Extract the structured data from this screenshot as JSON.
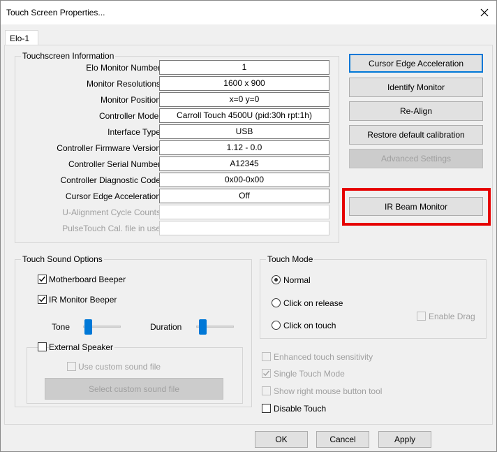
{
  "window": {
    "title": "Touch Screen Properties..."
  },
  "tabs": [
    {
      "label": "Elo-1"
    }
  ],
  "touchscreen_info": {
    "group_label": "Touchscreen Information",
    "rows": [
      {
        "label": "Elo Monitor Number",
        "value": "1",
        "enabled": true
      },
      {
        "label": "Monitor Resolutions",
        "value": "1600 x 900",
        "enabled": true
      },
      {
        "label": "Monitor Position",
        "value": "x=0  y=0",
        "enabled": true
      },
      {
        "label": "Controller Model",
        "value": "Carroll Touch 4500U (pid:30h rpt:1h)",
        "enabled": true
      },
      {
        "label": "Interface Type",
        "value": "USB",
        "enabled": true
      },
      {
        "label": "Controller Firmware Version",
        "value": "1.12 - 0.0",
        "enabled": true
      },
      {
        "label": "Controller Serial Number",
        "value": "A12345",
        "enabled": true
      },
      {
        "label": "Controller Diagnostic Code",
        "value": "0x00-0x00",
        "enabled": true
      },
      {
        "label": "Cursor Edge Acceleration",
        "value": "Off",
        "enabled": true
      },
      {
        "label": "U-Alignment Cycle Counts",
        "value": "",
        "enabled": false
      },
      {
        "label": "PulseTouch Cal. file in use",
        "value": "",
        "enabled": false
      }
    ]
  },
  "buttons": {
    "cursor_edge": "Cursor Edge Acceleration",
    "identify": "Identify Monitor",
    "realign": "Re-Align",
    "restore": "Restore default calibration",
    "advanced": "Advanced Settings",
    "ir_beam": "IR Beam Monitor"
  },
  "sound": {
    "group_label": "Touch Sound Options",
    "motherboard_beeper": "Motherboard Beeper",
    "motherboard_checked": true,
    "ir_monitor_beeper": "IR Monitor Beeper",
    "ir_checked": true,
    "tone_label": "Tone",
    "duration_label": "Duration",
    "external_speaker": "External Speaker",
    "external_checked": false,
    "use_custom": "Use custom sound file",
    "select_custom": "Select custom sound file"
  },
  "touch_mode": {
    "group_label": "Touch Mode",
    "options": [
      "Normal",
      "Click on release",
      "Click on touch"
    ],
    "selected": "Normal",
    "enable_drag": "Enable Drag"
  },
  "extra_options": {
    "enhanced": "Enhanced touch sensitivity",
    "single_touch": "Single Touch Mode",
    "single_touch_checked": true,
    "right_mouse": "Show right mouse button tool",
    "disable_touch": "Disable Touch"
  },
  "footer": {
    "ok": "OK",
    "cancel": "Cancel",
    "apply": "Apply"
  },
  "colors": {
    "highlight": "#e60000",
    "accent": "#0078d7"
  }
}
